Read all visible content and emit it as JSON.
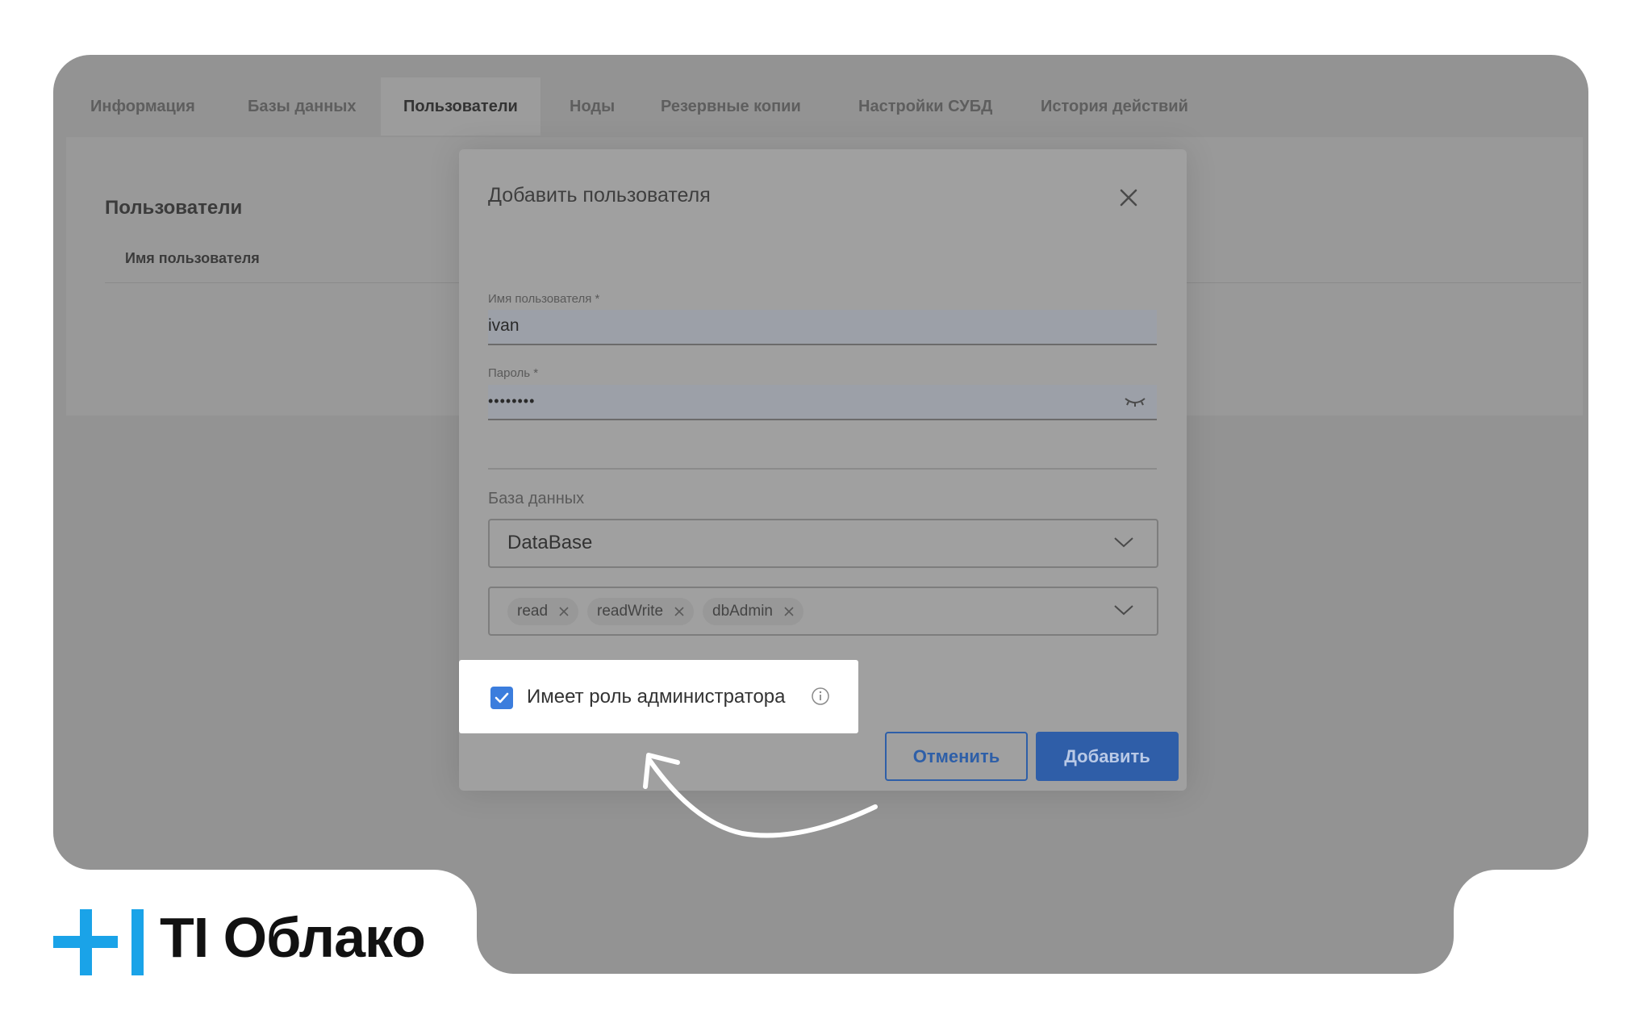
{
  "tabs": [
    "Информация",
    "Базы данных",
    "Пользователи",
    "Ноды",
    "Резервные копии",
    "Настройки СУБД",
    "История действий"
  ],
  "active_tab": "Пользователи",
  "panel": {
    "title": "Пользователи",
    "column_header": "Имя пользователя"
  },
  "dialog": {
    "title": "Добавить пользователя",
    "username_label": "Имя пользователя *",
    "username_value": "ivan",
    "password_label": "Пароль *",
    "password_value": "••••••••",
    "database_label": "База данных",
    "database_value": "DataBase",
    "roles": [
      "read",
      "readWrite",
      "dbAdmin"
    ],
    "admin_checkbox_label": "Имеет роль администратора",
    "admin_checked": true,
    "cancel_label": "Отменить",
    "add_label": "Добавить"
  },
  "logo": {
    "text": "TI Облако",
    "color": "#1aa3e8"
  },
  "icons": [
    "close-icon",
    "eye-hidden-icon",
    "chevron-down-icon",
    "chip-remove-icon",
    "checkmark-icon",
    "info-icon",
    "curved-arrow-icon"
  ]
}
